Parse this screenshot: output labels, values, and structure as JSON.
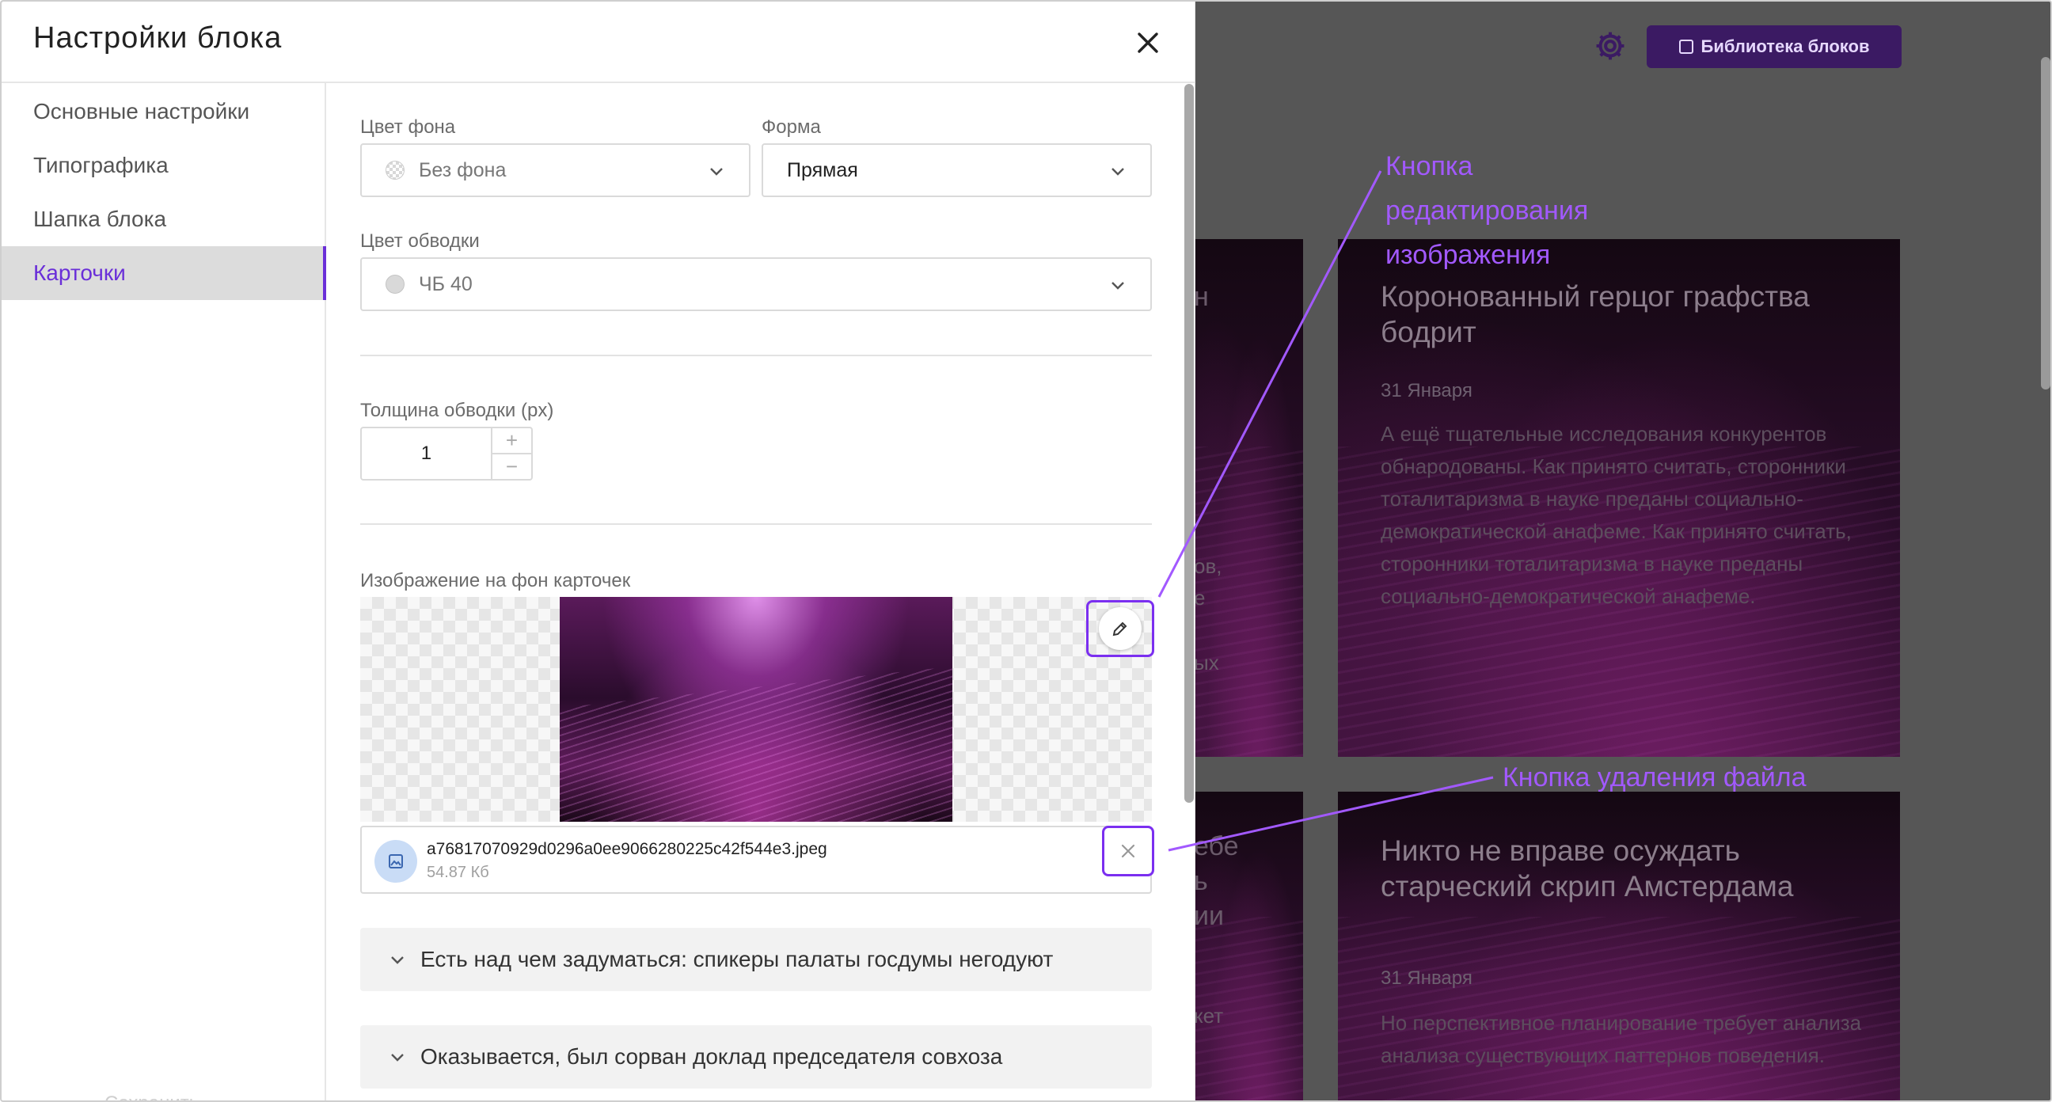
{
  "background": {
    "library_button_label": "Библиотека блоков",
    "cards": [
      {
        "title": "Коронованный герцог графства бодрит",
        "date": "31 Января",
        "text": "А ещё тщательные исследования конкурентов обнародованы. Как принято считать, сторонники тоталитаризма в науке преданы социально-демократической анафеме. Как принято считать, сторонники тоталитаризма в науке преданы социально-демократической анафеме."
      },
      {
        "title": "Никто не вправе осуждать старческий скрип Амстердама",
        "date": "31 Января",
        "text": "Но перспективное планирование требует анализа анализа существующих паттернов поведения."
      }
    ],
    "partial_fragments": [
      "н",
      "ов,",
      "е",
      "ых",
      "ебе",
      "ь",
      "ии",
      "кет"
    ]
  },
  "annotations": {
    "edit_button_note": "Кнопка редактирования изображения",
    "delete_button_note": "Кнопка удаления файла"
  },
  "panel": {
    "title": "Настройки блока",
    "sidebar": [
      {
        "label": "Основные настройки",
        "active": false
      },
      {
        "label": "Типографика",
        "active": false
      },
      {
        "label": "Шапка блока",
        "active": false
      },
      {
        "label": "Карточки",
        "active": true
      }
    ],
    "sidebar_faded": "Сохранить",
    "fields": {
      "bg_color": {
        "label": "Цвет фона",
        "value": "Без фона"
      },
      "shape": {
        "label": "Форма",
        "value": "Прямая"
      },
      "border_color": {
        "label": "Цвет обводки",
        "value": "ЧБ 40"
      },
      "border_width": {
        "label": "Толщина обводки (px)",
        "value": "1"
      },
      "bg_image": {
        "label": "Изображение на фон карточек"
      }
    },
    "file": {
      "name": "a76817070929d0296a0ee9066280225c42f544e3.jpeg",
      "size": "54.87 Кб"
    },
    "accordions": [
      "Есть над чем задуматься: спикеры палаты госдумы негодуют",
      "Оказывается, был сорван доклад председателя совхоза"
    ]
  },
  "colors": {
    "accent": "#6a2fd8",
    "annotation": "#a259ff",
    "overlay": "#565656"
  }
}
